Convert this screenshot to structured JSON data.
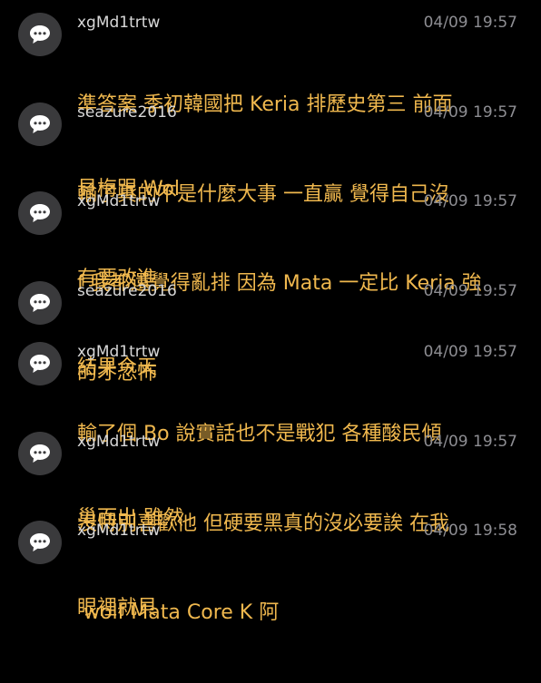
{
  "colors": {
    "background": "#000000",
    "username": "#d8d8d8",
    "timestamp": "#8e8e93",
    "content": "#f0b84e",
    "avatar": "#3a3a3c"
  },
  "avatar_icon": "speech-bubble-icon",
  "comments": [
    {
      "user": "xgMd1trtw",
      "time": "04/09 19:57",
      "line1": "準答案 季初韓國把 Keria 排歷史第三 前面",
      "line2": "貝梅跟 Wol"
    },
    {
      "user": "seazure2016",
      "time": "04/09 19:57",
      "line1": "輸了真的不是什麼大事 一直贏 覺得自己沒",
      "line2": "有要改進"
    },
    {
      "user": "xgMd1trtw",
      "time": "04/09 19:57",
      "line1": "f 我都還覺得亂排 因為 Mata 一定比 Keria 強",
      "line2": "結果今天"
    },
    {
      "user": "seazure2016",
      "time": "04/09 19:57",
      "line1": "的才恐怖",
      "line2": ""
    },
    {
      "user": "xgMd1trtw",
      "time": "04/09 19:57",
      "line1": "輸了個 Bo 說實話也不是戰犯 各種酸民傾",
      "line2": "巢而出 雖然"
    },
    {
      "user": "xgMd1trtw",
      "time": "04/09 19:57",
      "line1": "沒特別喜歡他 但硬要黑真的沒必要誒 在我",
      "line2": "眼裡就貝"
    },
    {
      "user": "xgMd1trtw",
      "time": "04/09 19:58",
      "line1": " wolf Mata Core K 阿",
      "line2": ""
    }
  ]
}
